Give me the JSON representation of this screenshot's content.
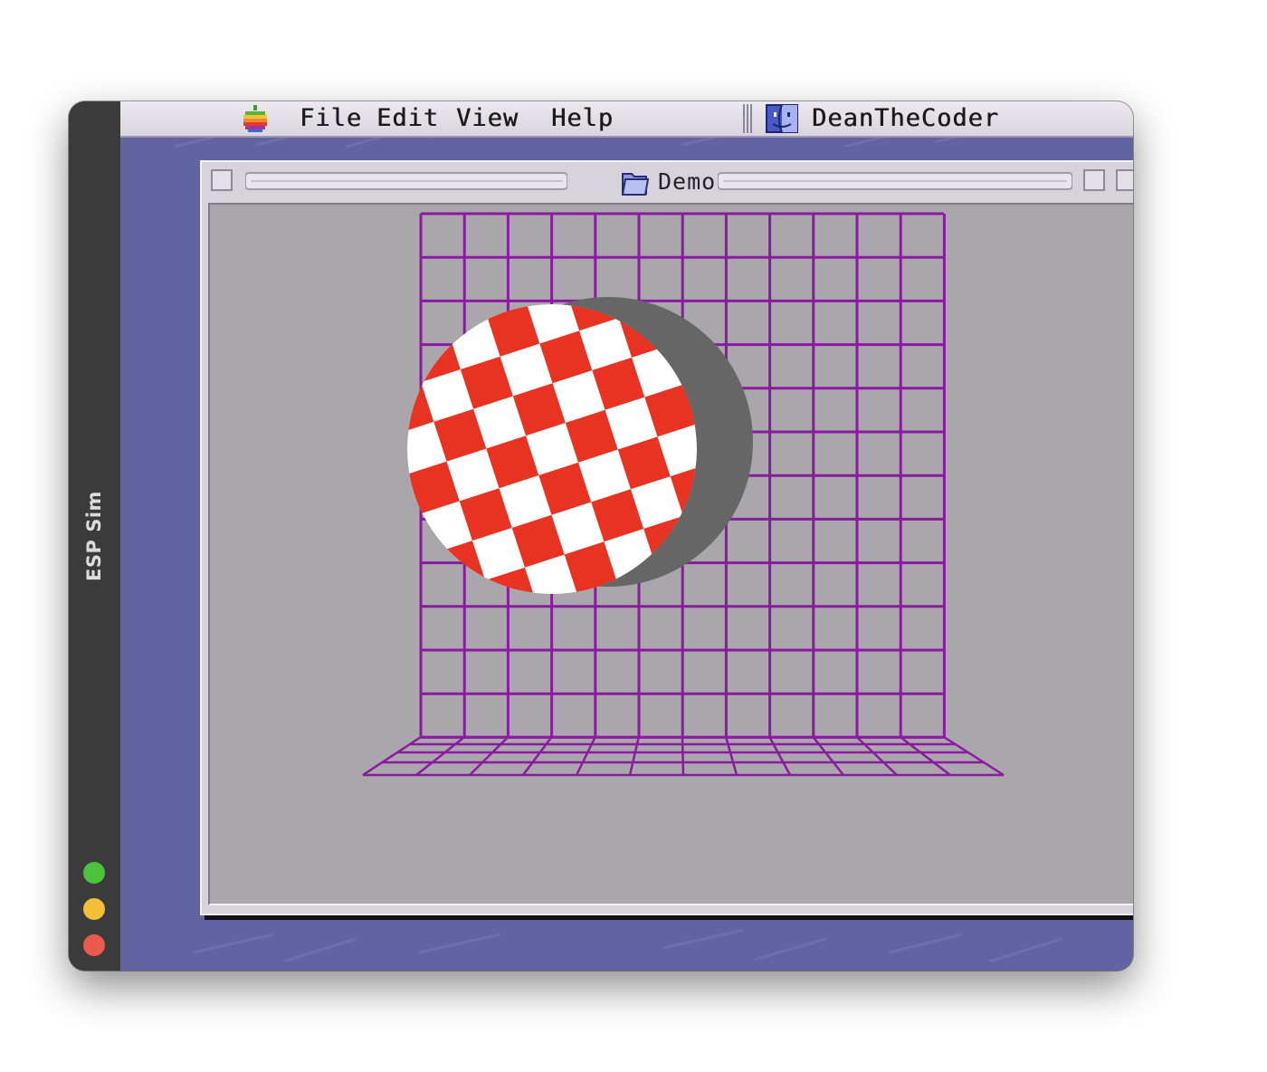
{
  "sim": {
    "title": "ESP Sim",
    "traffic_lights": [
      {
        "name": "green",
        "color": "#4cc23d"
      },
      {
        "name": "yellow",
        "color": "#f3bf3a"
      },
      {
        "name": "red",
        "color": "#e9594d"
      }
    ]
  },
  "menubar": {
    "apple_icon": "apple-logo-icon",
    "items": [
      "File",
      "Edit",
      "View",
      "Help"
    ],
    "app_icon": "finder-icon",
    "app_name": "DeanTheCoder"
  },
  "window": {
    "title": "Demos",
    "title_icon": "folder-icon"
  },
  "demo": {
    "grid_color": "#8a1aa0",
    "ball_red": "#e83222",
    "ball_white": "#ffffff",
    "shadow_color": "#666666",
    "background": "#a9a7ab",
    "desktop_color": "#6264a2"
  }
}
